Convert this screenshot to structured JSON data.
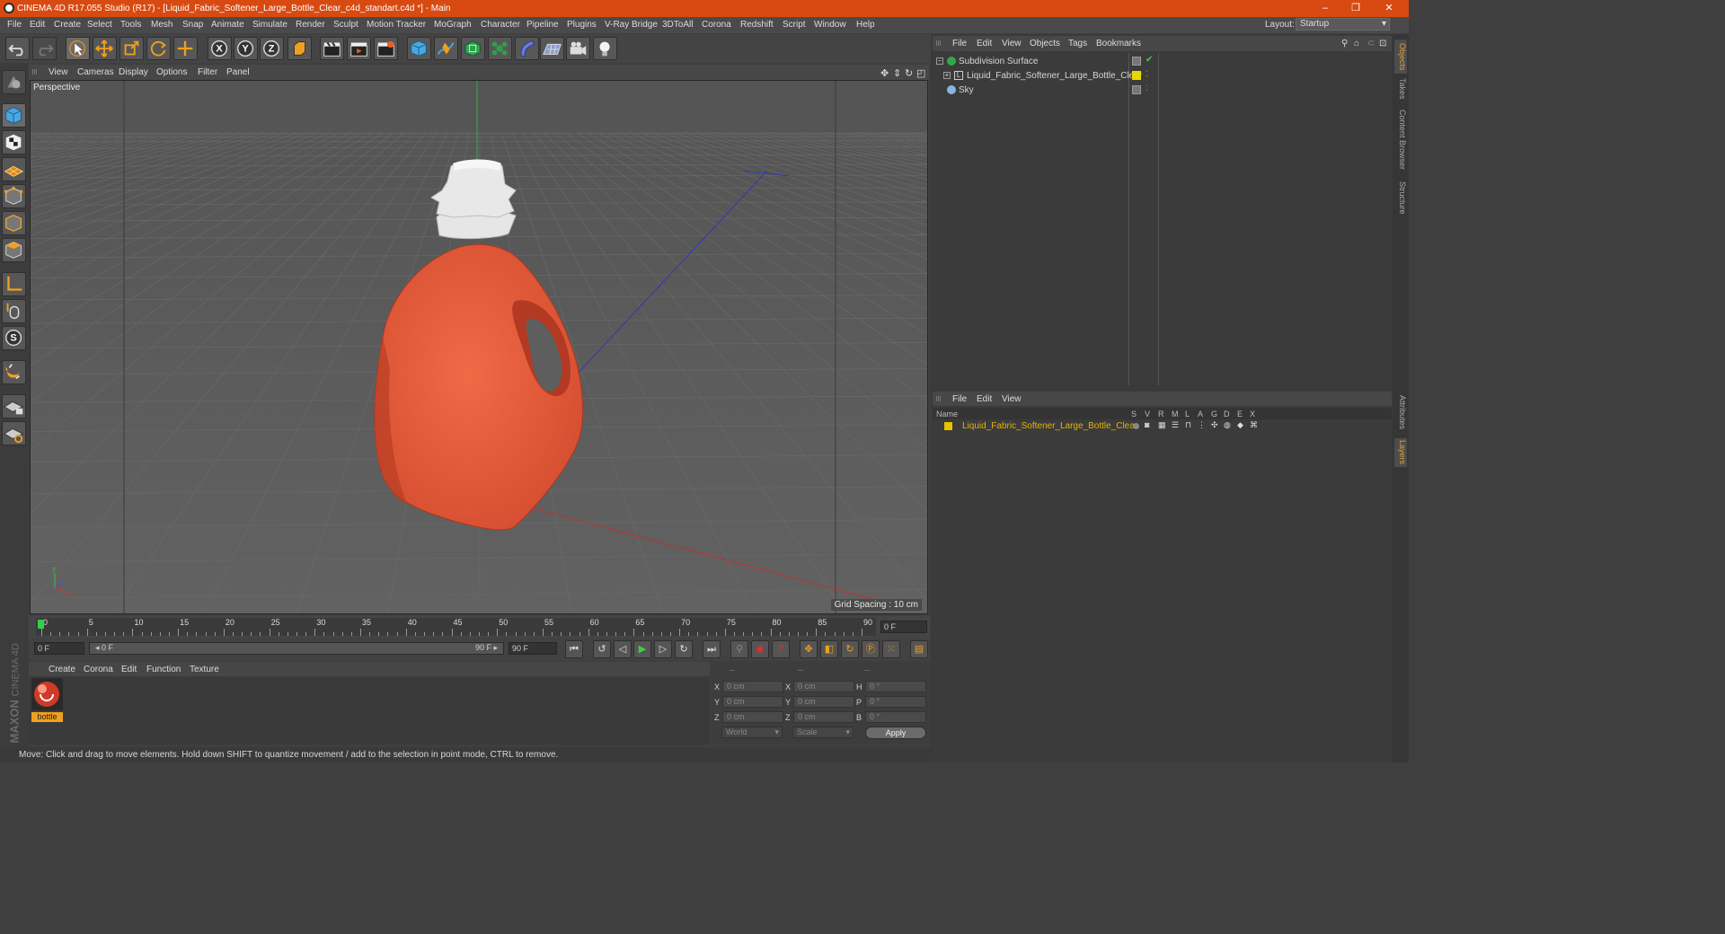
{
  "window": {
    "title": "CINEMA 4D R17.055 Studio (R17) - [Liquid_Fabric_Softener_Large_Bottle_Clear_c4d_standart.c4d *] - Main",
    "minimize": "–",
    "restore": "❐",
    "close": "✕"
  },
  "menubar": {
    "items": [
      "File",
      "Edit",
      "Create",
      "Select",
      "Tools",
      "Mesh",
      "Snap",
      "Animate",
      "Simulate",
      "Render",
      "Sculpt",
      "Motion Tracker",
      "MoGraph",
      "Character",
      "Pipeline",
      "Plugins",
      "V-Ray Bridge",
      "3DToAll",
      "Corona",
      "Redshift",
      "Script",
      "Window",
      "Help"
    ],
    "layout_label": "Layout:",
    "layout_value": "Startup"
  },
  "viewport": {
    "menu": [
      "View",
      "Cameras",
      "Display",
      "Options",
      "Filter",
      "Panel"
    ],
    "label": "Perspective",
    "grid_spacing": "Grid Spacing : 10 cm",
    "axis_x": "x",
    "axis_y": "y"
  },
  "timeline": {
    "ticks": [
      "0",
      "5",
      "10",
      "15",
      "20",
      "25",
      "30",
      "35",
      "40",
      "45",
      "50",
      "55",
      "60",
      "65",
      "70",
      "75",
      "80",
      "85",
      "90"
    ],
    "current_frame": "0 F",
    "start_field": "0 F",
    "range_start": "0 F",
    "range_end": "90 F",
    "end_field": "90 F"
  },
  "material": {
    "menu": [
      "Create",
      "Corona",
      "Edit",
      "Function",
      "Texture"
    ],
    "material_name": "bottle"
  },
  "coordinates": {
    "header": [
      "--",
      "--",
      "--"
    ],
    "pos_labels": [
      "X",
      "Y",
      "Z"
    ],
    "pos_values": [
      "0 cm",
      "0 cm",
      "0 cm"
    ],
    "size_labels": [
      "X",
      "Y",
      "Z"
    ],
    "size_values": [
      "0 cm",
      "0 cm",
      "0 cm"
    ],
    "rot_labels": [
      "H",
      "P",
      "B"
    ],
    "rot_values": [
      "0 °",
      "0 °",
      "0 °"
    ],
    "mode_world": "World",
    "mode_scale": "Scale",
    "apply": "Apply"
  },
  "status": "Move: Click and drag to move elements. Hold down SHIFT to quantize movement / add to the selection in point mode, CTRL to remove.",
  "objects_panel": {
    "menu": [
      "File",
      "Edit",
      "View",
      "Objects",
      "Tags",
      "Bookmarks"
    ],
    "rows": [
      {
        "name": "Subdivision Surface"
      },
      {
        "name": "Liquid_Fabric_Softener_Large_Bottle_Clear"
      },
      {
        "name": "Sky"
      }
    ]
  },
  "layers_panel": {
    "menu": [
      "File",
      "Edit",
      "View"
    ],
    "header_name": "Name",
    "columns": [
      "S",
      "V",
      "R",
      "M",
      "L",
      "A",
      "G",
      "D",
      "E",
      "X"
    ],
    "row_name": "Liquid_Fabric_Softener_Large_Bottle_Clear",
    "row_color": "#e8c200"
  },
  "side_tabs": [
    "Objects",
    "Takes",
    "Content Browser",
    "Structure",
    "Attributes",
    "Layers"
  ],
  "brand": {
    "maxon": "MAXON",
    "cinema": "CINEMA 4D"
  },
  "colors": {
    "accent": "#d84a11",
    "bottle": "#e85a3a",
    "cap": "#e6e6e6"
  }
}
